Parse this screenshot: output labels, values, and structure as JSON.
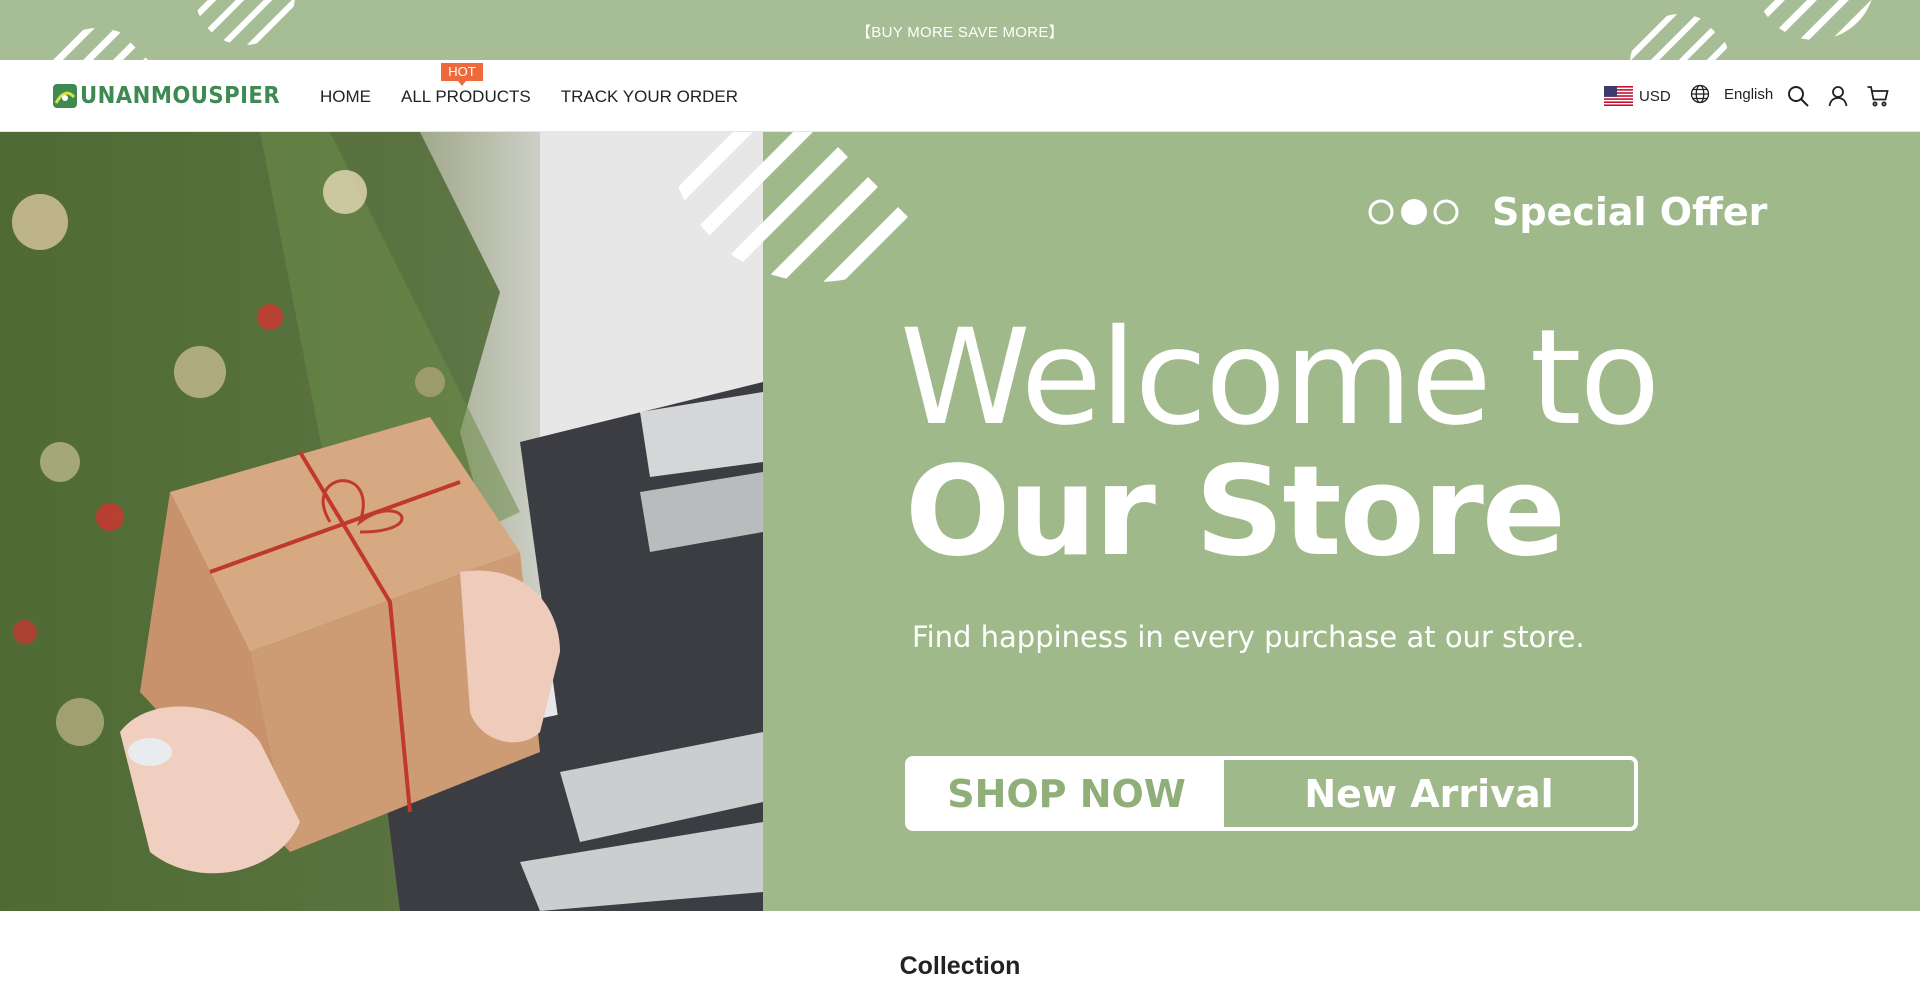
{
  "announcement": {
    "text": "【BUY MORE SAVE MORE】"
  },
  "brand": {
    "logo_text": "UNANMOUSPIER"
  },
  "nav": {
    "items": [
      {
        "label": "HOME"
      },
      {
        "label": "ALL PRODUCTS",
        "badge": "HOT"
      },
      {
        "label": "TRACK YOUR ORDER"
      }
    ]
  },
  "header_tools": {
    "currency": "USD",
    "language": "English",
    "icons": [
      "globe-icon",
      "search-icon",
      "account-icon",
      "cart-icon",
      "us-flag-icon"
    ]
  },
  "hero": {
    "offer_label": "Special Offer",
    "headline_line1": "Welcome to",
    "headline_line2": "Our Store",
    "tagline": "Find happiness in every purchase at our store.",
    "cta_primary": "SHOP NOW",
    "cta_secondary": "New Arrival"
  },
  "collection": {
    "title": "Collection"
  },
  "colors": {
    "announcement_bg": "#a6bd95",
    "hero_green": "#a0b98a",
    "brand_green": "#3e8a52",
    "hot_badge": "#ef6a3a",
    "cta_text_green": "#8fae78"
  }
}
